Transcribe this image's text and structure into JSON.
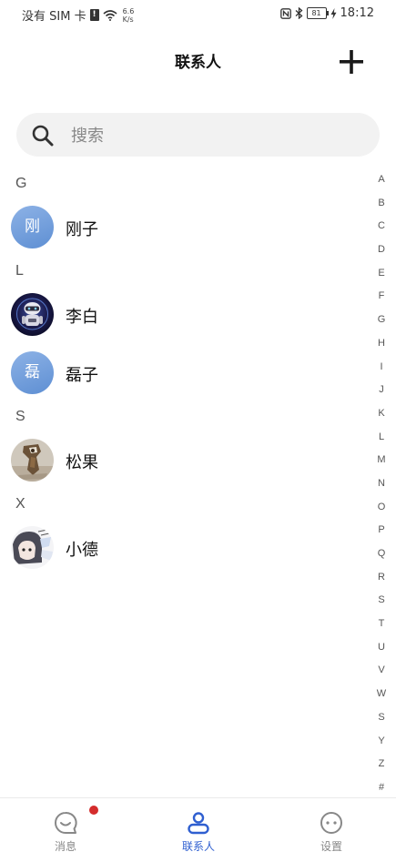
{
  "status_bar": {
    "carrier": "没有 SIM 卡",
    "alert_glyph": "!",
    "net_speed_value": "6.6",
    "net_speed_unit": "K/s",
    "battery": "81",
    "time": "18:12"
  },
  "header": {
    "title": "联系人",
    "add_icon": "plus-icon"
  },
  "search": {
    "placeholder": "搜索",
    "icon": "search-icon"
  },
  "contacts": {
    "sections": [
      {
        "letter": "G",
        "items": [
          {
            "name": "刚子",
            "avatar_text": "刚",
            "avatar_type": "initial"
          }
        ]
      },
      {
        "letter": "L",
        "items": [
          {
            "name": "李白",
            "avatar_type": "photo"
          },
          {
            "name": "磊子",
            "avatar_text": "磊",
            "avatar_type": "initial"
          }
        ]
      },
      {
        "letter": "S",
        "items": [
          {
            "name": "松果",
            "avatar_type": "photo"
          }
        ]
      },
      {
        "letter": "X",
        "items": [
          {
            "name": "小德",
            "avatar_type": "photo"
          }
        ]
      }
    ]
  },
  "index_bar": [
    "A",
    "B",
    "C",
    "D",
    "E",
    "F",
    "G",
    "H",
    "I",
    "J",
    "K",
    "L",
    "M",
    "N",
    "O",
    "P",
    "Q",
    "R",
    "S",
    "T",
    "U",
    "V",
    "W",
    "S",
    "Y",
    "Z",
    "#"
  ],
  "bottom_nav": {
    "items": [
      {
        "label": "消息",
        "icon": "message-icon",
        "active": false,
        "badge": true
      },
      {
        "label": "联系人",
        "icon": "contacts-icon",
        "active": true,
        "badge": false
      },
      {
        "label": "设置",
        "icon": "settings-icon",
        "active": false,
        "badge": false
      }
    ]
  },
  "colors": {
    "accent": "#2f5fd0",
    "badge": "#d42c2c",
    "avatar_gradient_start": "#8db2e6",
    "avatar_gradient_end": "#5e8fd3",
    "search_bg": "#f2f2f2"
  }
}
